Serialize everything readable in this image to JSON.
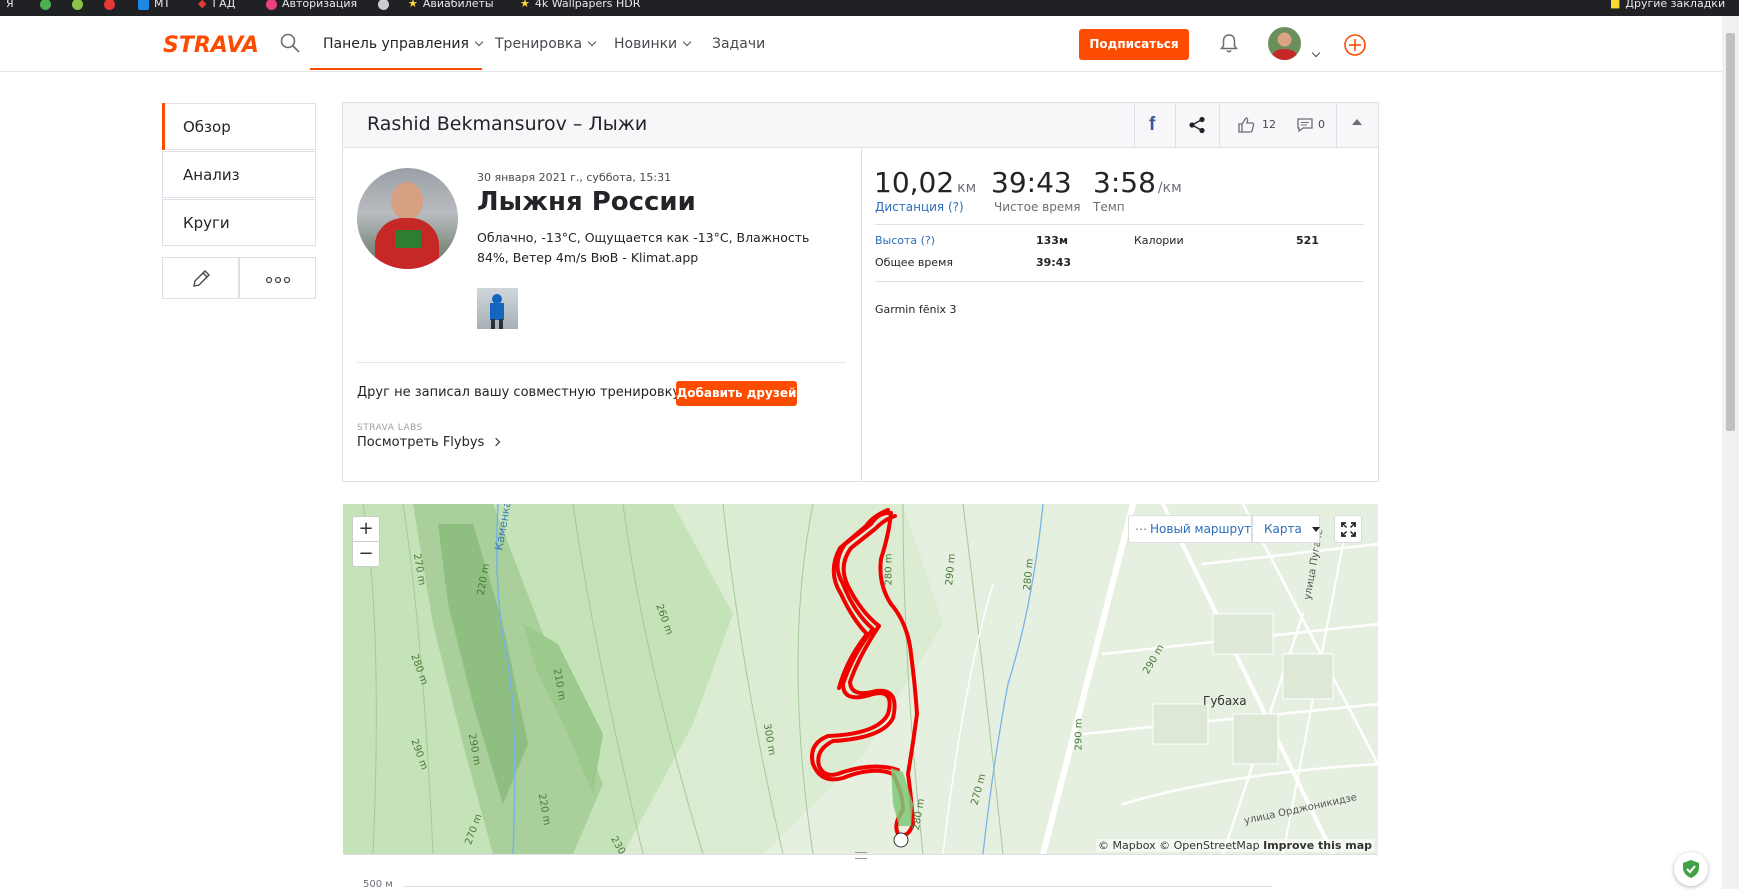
{
  "bookmarks_bar": {
    "items": [
      "Я",
      "MT",
      "ГАД",
      "Авторизация",
      "Авиабилеты",
      "4k Wallpapers HDR"
    ],
    "right": "Другие закладки"
  },
  "nav": {
    "logo": "STRAVA",
    "items": [
      {
        "label": "Панель управления",
        "has_caret": true,
        "active": true
      },
      {
        "label": "Тренировка",
        "has_caret": true
      },
      {
        "label": "Новинки",
        "has_caret": true
      },
      {
        "label": "Задачи",
        "has_caret": false
      }
    ],
    "subscribe_label": "Подписаться",
    "accent": "#fc4c02"
  },
  "sidebar": {
    "items": [
      {
        "label": "Обзор",
        "active": true
      },
      {
        "label": "Анализ"
      },
      {
        "label": "Круги"
      }
    ]
  },
  "activity": {
    "header_title": "Rashid Bekmansurov – Лыжи",
    "kudos_count": "12",
    "comments_count": "0",
    "date": "30 января 2021 г., суббота, 15:31",
    "title": "Лыжня России",
    "weather": "Облачно, -13°C, Ощущается как -13°C, Влажность 84%, Ветер 4m/s ВюВ - Klimat.app",
    "friends_prompt": "Друг не записал вашу совместную тренировку?",
    "add_friends_label": "Добавить друзей",
    "labs_label": "STRAVA LABS",
    "flyby_label": "Посмотреть Flybys"
  },
  "stats": {
    "primary": [
      {
        "value": "10,02",
        "unit": "км",
        "label": "Дистанция (?)",
        "is_link": true
      },
      {
        "value": "39:43",
        "unit": "",
        "label": "Чистое время",
        "is_link": false
      },
      {
        "value": "3:58",
        "unit": "/км",
        "label": "Темп",
        "is_link": false
      }
    ],
    "elevation_label": "Высота (?)",
    "elevation_value": "133м",
    "calories_label": "Калории",
    "calories_value": "521",
    "elapsed_label": "Общее время",
    "elapsed_value": "39:43",
    "device": "Garmin fēnix 3"
  },
  "map": {
    "zoom_in": "+",
    "zoom_out": "−",
    "new_route_label": "Новый маршрут",
    "map_type_label": "Карта",
    "town_label": "Губаха",
    "river_label": "Каменка",
    "street_labels": [
      "улица Орджоникидзе",
      "улица Пугачё"
    ],
    "contour_labels": [
      "270 m",
      "220 m",
      "280 m",
      "290 m",
      "260 m",
      "210 m",
      "220 m",
      "270 m",
      "290 m",
      "280 m",
      "300 m",
      "290 m",
      "270 m",
      "280 m",
      "290 m",
      "290 m",
      "280 m",
      "230"
    ],
    "attribution_mapbox": "© Mapbox",
    "attribution_osm": "© OpenStreetMap",
    "attribution_improve": "Improve this map",
    "route_color": "#f20000"
  },
  "elevation_chart": {
    "y_label": "500 м"
  }
}
